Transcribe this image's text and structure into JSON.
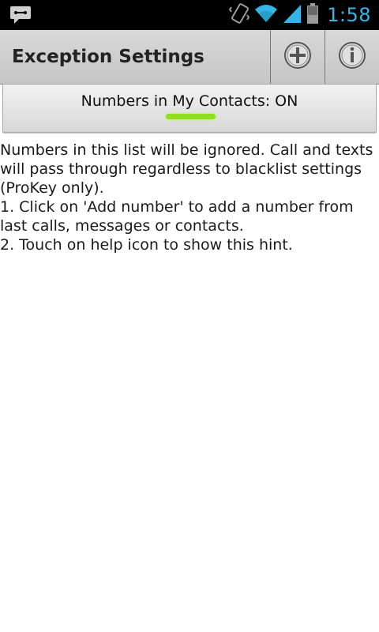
{
  "status_bar": {
    "time": "1:58",
    "accent_color": "#33b5e5",
    "icons": [
      "message-notification-icon",
      "vibrate-icon",
      "wifi-icon",
      "signal-icon",
      "battery-icon"
    ]
  },
  "action_bar": {
    "title": "Exception Settings",
    "buttons": [
      {
        "name": "add-number-button",
        "icon": "plus-circle-icon"
      },
      {
        "name": "help-button",
        "icon": "info-circle-icon"
      }
    ]
  },
  "toggle": {
    "label": "Numbers in My Contacts: ON",
    "state": "on",
    "indicator_color": "#8fe01a"
  },
  "hint": {
    "lines": [
      "Numbers in this list will be ignored. Call and texts will pass through regardless to blacklist settings (ProKey only).",
      "1. Click on 'Add number' to add a number from last calls, messages or contacts.",
      "2. Touch on help icon to show this hint."
    ]
  }
}
